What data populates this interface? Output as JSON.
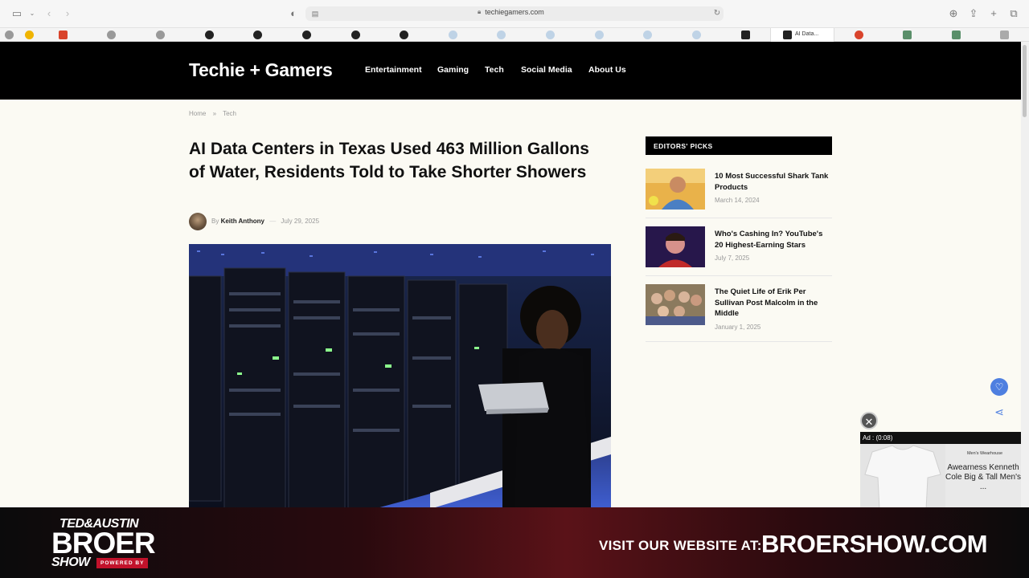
{
  "browser": {
    "url": "techiegamers.com",
    "active_tab_label": "AI Data..."
  },
  "site": {
    "logo": "Techie + Gamers",
    "nav": [
      "Entertainment",
      "Gaming",
      "Tech",
      "Social Media",
      "About Us"
    ]
  },
  "breadcrumb": {
    "home": "Home",
    "sep": "»",
    "current": "Tech"
  },
  "article": {
    "title": "AI Data Centers in Texas Used 463 Million Gallons of Water, Residents Told to Take Shorter Showers",
    "by": "By",
    "author": "Keith Anthony",
    "dash": "—",
    "date": "July 29, 2025"
  },
  "sidebar": {
    "heading": "EDITORS' PICKS",
    "items": [
      {
        "title": "10 Most Successful Shark Tank Products",
        "date": "March 14, 2024"
      },
      {
        "title": "Who's Cashing In? YouTube's 20 Highest-Earning Stars",
        "date": "July 7, 2025"
      },
      {
        "title": "The Quiet Life of Erik Per Sullivan Post Malcolm in the Middle",
        "date": "January 1, 2025"
      }
    ]
  },
  "ad": {
    "timer": "Ad : (0:08)",
    "brand": "Men's Wearhouse",
    "text": "Awearness Kenneth Cole Big & Tall Men's ..."
  },
  "banner": {
    "ted_austin": "TED&AUSTIN",
    "broer": "BROER",
    "show": "SHOW",
    "powered": "POWERED BY",
    "visit": "VISIT OUR WEBSITE AT:",
    "site": "BROERSHOW.COM"
  },
  "colors": {
    "header_bg": "#000000",
    "page_bg": "#fbfaf3",
    "accent_blue": "#4e7fe0",
    "banner_red": "#c2122b"
  },
  "icons": [
    "sidebar-toggle-icon",
    "back-icon",
    "forward-icon",
    "shield-icon",
    "reader-icon",
    "lock-icon",
    "reload-icon",
    "download-icon",
    "share-icon",
    "new-tab-icon",
    "tabs-icon",
    "heart-icon",
    "close-icon"
  ]
}
